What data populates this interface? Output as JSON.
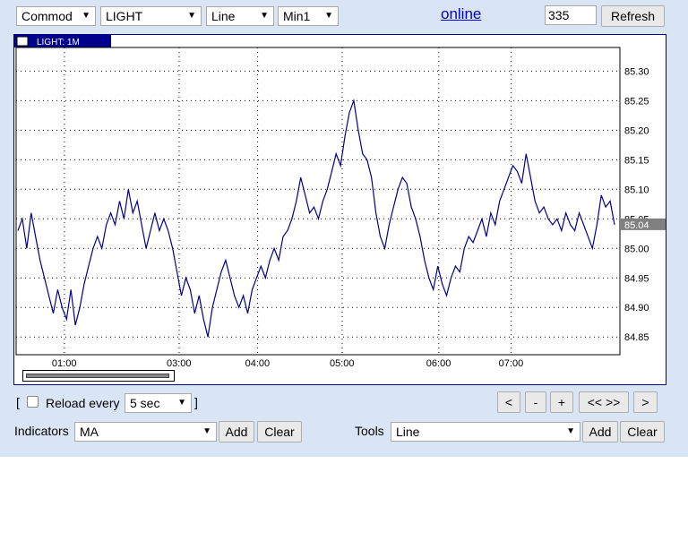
{
  "toolbar": {
    "market": "Commod",
    "symbol": "LIGHT",
    "chart_type": "Line",
    "interval": "Min1",
    "online_link": "online",
    "count_value": "335",
    "refresh_label": "Refresh"
  },
  "chart_tag": "LIGHT: 1M",
  "chart_tag_icon": "chart-icon",
  "colors": {
    "panel_bg": "#d9e5f5",
    "series": "#00008b",
    "frame": "#00008b",
    "last_price_bg": "#808080"
  },
  "reload": {
    "open_bracket": "[",
    "label": "Reload every",
    "value": "5 sec",
    "close_bracket": "]",
    "checked": false
  },
  "nav": [
    "<",
    "-",
    "+",
    "<< >>",
    ">"
  ],
  "indicators": {
    "label": "Indicators",
    "value": "MA",
    "add": "Add",
    "clear": "Clear"
  },
  "tools": {
    "label": "Tools",
    "value": "Line",
    "add": "Add",
    "clear": "Clear"
  },
  "chart_data": {
    "type": "line",
    "title": "LIGHT: 1M",
    "xlabel": "",
    "ylabel": "",
    "x_ticks": [
      "01:00",
      "03:00",
      "04:00",
      "05:00",
      "06:00",
      "07:00"
    ],
    "y_ticks": [
      "84.85",
      "84.90",
      "84.95",
      "85.00",
      "85.05",
      "85.10",
      "85.15",
      "85.20",
      "85.25",
      "85.30"
    ],
    "ylim": [
      84.82,
      85.34
    ],
    "last_value": "85.04",
    "grid": true,
    "series": [
      {
        "values": [
          85.03,
          85.05,
          85.0,
          85.06,
          85.02,
          84.98,
          84.95,
          84.92,
          84.89,
          84.93,
          84.9,
          84.88,
          84.93,
          84.87,
          84.9,
          84.94,
          84.97,
          85.0,
          85.02,
          85.0,
          85.04,
          85.06,
          85.04,
          85.08,
          85.05,
          85.1,
          85.06,
          85.08,
          85.04,
          85.0,
          85.03,
          85.06,
          85.03,
          85.05,
          85.03,
          85.0,
          84.96,
          84.92,
          84.95,
          84.93,
          84.89,
          84.92,
          84.88,
          84.85,
          84.9,
          84.93,
          84.96,
          84.98,
          84.95,
          84.92,
          84.9,
          84.92,
          84.89,
          84.93,
          84.95,
          84.97,
          84.95,
          84.98,
          85.0,
          84.98,
          85.02,
          85.03,
          85.05,
          85.08,
          85.12,
          85.09,
          85.06,
          85.07,
          85.05,
          85.08,
          85.1,
          85.13,
          85.16,
          85.14,
          85.19,
          85.23,
          85.25,
          85.2,
          85.16,
          85.15,
          85.12,
          85.06,
          85.02,
          85.0,
          85.04,
          85.07,
          85.1,
          85.12,
          85.11,
          85.07,
          85.05,
          85.02,
          84.98,
          84.95,
          84.93,
          84.97,
          84.94,
          84.92,
          84.95,
          84.97,
          84.96,
          85.0,
          85.02,
          85.01,
          85.03,
          85.05,
          85.02,
          85.06,
          85.04,
          85.08,
          85.1,
          85.12,
          85.14,
          85.13,
          85.11,
          85.16,
          85.12,
          85.08,
          85.06,
          85.07,
          85.05,
          85.04,
          85.05,
          85.03,
          85.06,
          85.04,
          85.03,
          85.06,
          85.04,
          85.02,
          85.0,
          85.04,
          85.09,
          85.07,
          85.08,
          85.04
        ]
      }
    ]
  }
}
